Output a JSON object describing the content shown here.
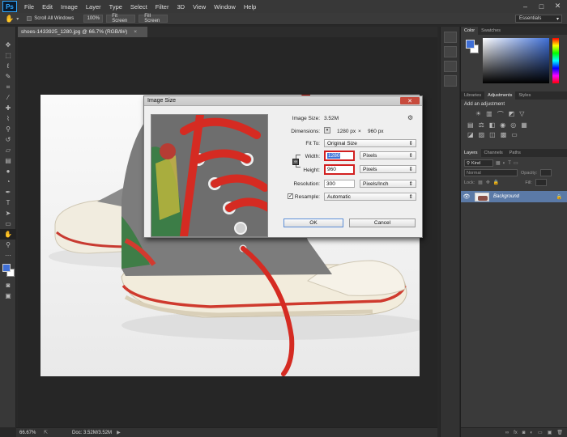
{
  "app": {
    "logo": "Ps"
  },
  "menu": [
    "File",
    "Edit",
    "Image",
    "Layer",
    "Type",
    "Select",
    "Filter",
    "3D",
    "View",
    "Window",
    "Help"
  ],
  "window_controls": [
    "–",
    "□",
    "✕"
  ],
  "options": {
    "scroll_all_label": "Scroll All Windows",
    "btn_100": "100%",
    "btn_fit": "Fit Screen",
    "btn_fill": "Fill Screen",
    "workspace": "Essentials"
  },
  "doc_tab": {
    "title": "shoes-1433925_1280.jpg @ 66.7% (RGB/8#)",
    "close": "×"
  },
  "status": {
    "zoom": "66.67%",
    "doc": "Doc: 3.52M/3.52M"
  },
  "dialog": {
    "title": "Image Size",
    "close": "✕",
    "image_size_label": "Image Size:",
    "image_size_value": "3.52M",
    "dimensions_label": "Dimensions:",
    "dimensions_w": "1280 px",
    "dimensions_x": "×",
    "dimensions_h": "960 px",
    "fit_to_label": "Fit To:",
    "fit_to_value": "Original Size",
    "width_label": "Width:",
    "width_value": "1280",
    "width_unit": "Pixels",
    "height_label": "Height:",
    "height_value": "960",
    "height_unit": "Pixels",
    "resolution_label": "Resolution:",
    "resolution_value": "300",
    "resolution_unit": "Pixels/Inch",
    "resample_label": "Resample:",
    "resample_value": "Automatic",
    "ok": "OK",
    "cancel": "Cancel"
  },
  "panels": {
    "color_tabs": [
      "Color",
      "Swatches"
    ],
    "adj_tabs": [
      "Libraries",
      "Adjustments",
      "Styles"
    ],
    "adj_heading": "Add an adjustment",
    "layers_tabs": [
      "Layers",
      "Channels",
      "Paths"
    ],
    "kind": "Kind",
    "blend": "Normal",
    "opacity_label": "Opacity:",
    "lock_label": "Lock:",
    "fill_label": "Fill:",
    "layer_name": "Background"
  },
  "colors": {
    "fg": "#3f6fd6",
    "bg": "#ffffff",
    "accent": "#d21f1f"
  }
}
